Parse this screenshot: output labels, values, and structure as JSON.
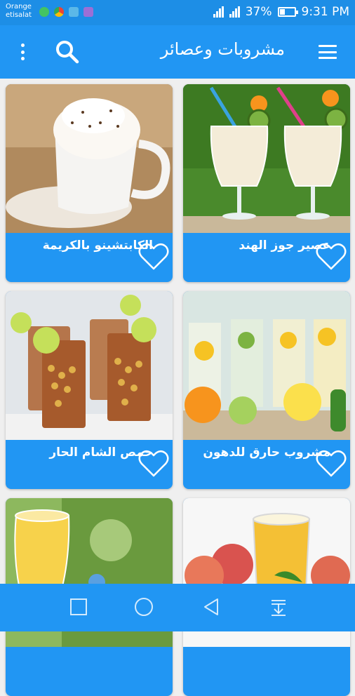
{
  "status_bar": {
    "carrier_line1": "Orange",
    "carrier_line2": "etisalat",
    "battery_percent": "37%",
    "time": "9:31 PM",
    "battery_level": 0.37
  },
  "app_bar": {
    "title": "مشروبات وعصائر",
    "icons": [
      "menu-icon",
      "search-icon",
      "more-vert-icon"
    ]
  },
  "drinks": [
    {
      "name": "عصير جوز الهند",
      "image": "coconut-juice-photo"
    },
    {
      "name": "الكابتشينو بالكريمة",
      "image": "cappuccino-photo"
    },
    {
      "name": "مشروب حارق للدهون",
      "image": "fat-burning-drink-photo"
    },
    {
      "name": "حمص الشام الحار",
      "image": "hot-chickpea-drink-photo"
    },
    {
      "name": "",
      "image": "peach-juice-photo"
    },
    {
      "name": "",
      "image": "lemonade-photo"
    }
  ],
  "nav_bar": {
    "icons": [
      "recents-square-icon",
      "home-circle-icon",
      "back-triangle-icon",
      "notification-pull-icon"
    ]
  },
  "colors": {
    "status_bar": "#1d8ee6",
    "primary": "#2196f3",
    "background": "#efefef"
  }
}
